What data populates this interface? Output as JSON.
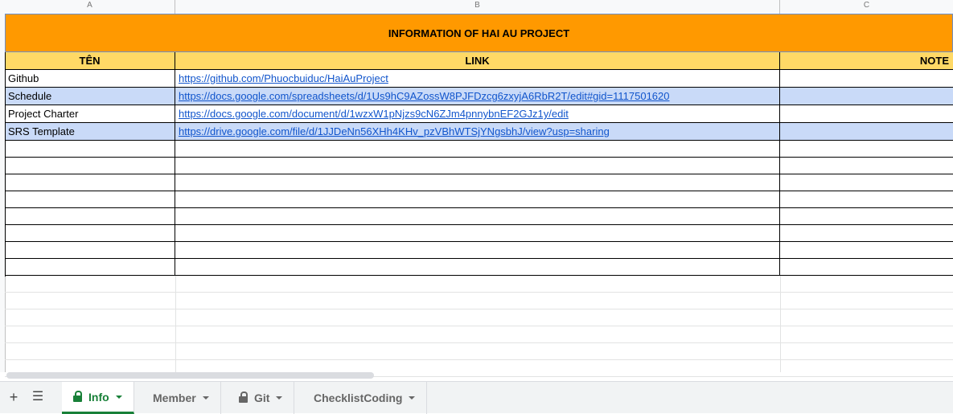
{
  "columns": [
    "A",
    "B",
    "C"
  ],
  "title": "INFORMATION OF HAI AU PROJECT",
  "headers": {
    "ten": "TÊN",
    "link": "LINK",
    "note": "NOTE"
  },
  "rows": [
    {
      "name": "Github",
      "link": "https://github.com/Phuocbuiduc/HaiAuProject",
      "highlight": false
    },
    {
      "name": "Schedule",
      "link": "https://docs.google.com/spreadsheets/d/1Us9hC9AZossW8PJFDzcg6zxyjA6RbR2T/edit#gid=1117501620",
      "highlight": true
    },
    {
      "name": "Project Charter",
      "link": "https://docs.google.com/document/d/1wzxW1pNjzs9cN6ZJm4pnnybnEF2GJz1y/edit",
      "highlight": false
    },
    {
      "name": "SRS Template",
      "link": "https://drive.google.com/file/d/1JJDeNn56XHh4KHv_pzVBhWTSjYNgsbhJ/view?usp=sharing",
      "highlight": true
    }
  ],
  "tabs": [
    {
      "label": "Info",
      "locked": true,
      "active": true
    },
    {
      "label": "Member",
      "locked": false,
      "active": false
    },
    {
      "label": "Git",
      "locked": true,
      "active": false
    },
    {
      "label": "ChecklistCoding",
      "locked": false,
      "active": false
    }
  ],
  "toolbar": {
    "add_icon": "plus-icon",
    "list_icon": "all-sheets-icon"
  },
  "colors": {
    "title_bg": "#ff9900",
    "header_bg": "#ffd966",
    "row_highlight": "#c9daf8",
    "link": "#1155cc",
    "active_tab": "#188038"
  }
}
